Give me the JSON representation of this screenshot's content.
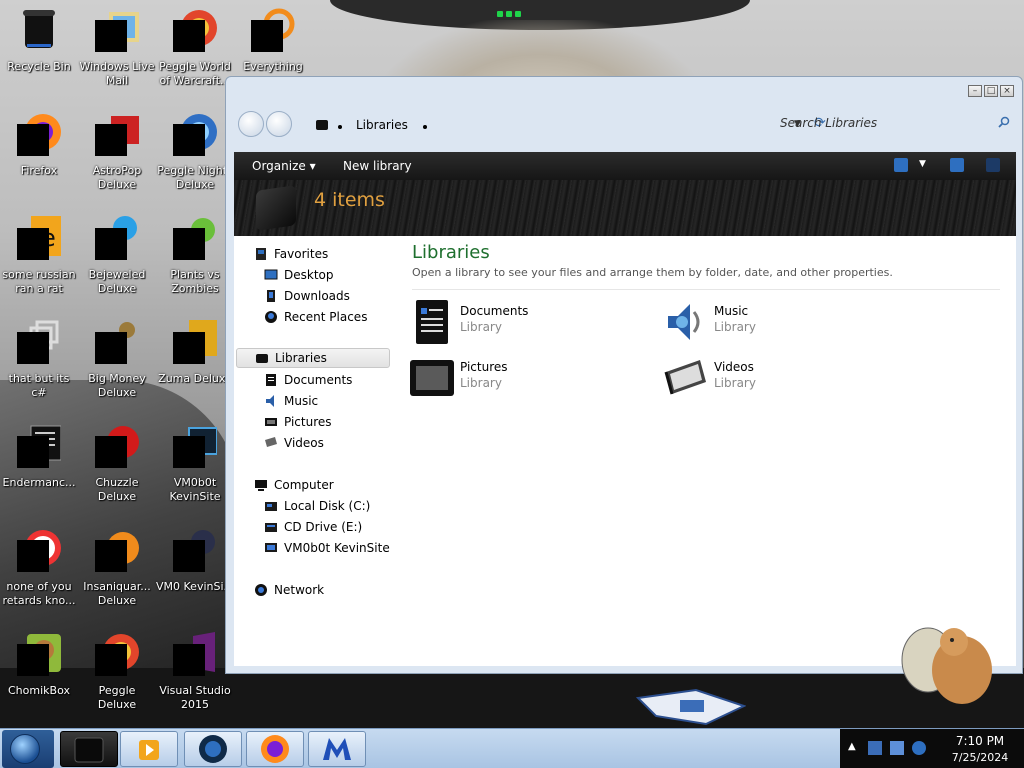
{
  "desktop": {
    "icons": [
      {
        "label": "Recycle Bin"
      },
      {
        "label": "Windows Live Mail"
      },
      {
        "label": "Peggle World of Warcraft..."
      },
      {
        "label": "Everything"
      },
      {
        "label": "Firefox"
      },
      {
        "label": "AstroPop Deluxe"
      },
      {
        "label": "Peggle Nights Deluxe"
      },
      {
        "label": "some russian ran a rat"
      },
      {
        "label": "Bejeweled Deluxe"
      },
      {
        "label": "Plants vs Zombies"
      },
      {
        "label": "that but its c#"
      },
      {
        "label": "Big Money Deluxe"
      },
      {
        "label": "Zuma Deluxe"
      },
      {
        "label": "Endermanc..."
      },
      {
        "label": "Chuzzle Deluxe"
      },
      {
        "label": "VM0b0t KevinSite"
      },
      {
        "label": "none of you retards kno..."
      },
      {
        "label": "Insaniquar... Deluxe"
      },
      {
        "label": "VM0 KevinSi..."
      },
      {
        "label": "ChomikBox"
      },
      {
        "label": "Peggle Deluxe"
      },
      {
        "label": "Visual Studio 2015"
      }
    ]
  },
  "window": {
    "address": {
      "location": "Libraries"
    },
    "search": {
      "placeholder": "Search Libraries"
    },
    "toolbar": {
      "organize": "Organize ▾",
      "new_library": "New library"
    },
    "banner": {
      "count": "4 items"
    },
    "nav": {
      "favorites": "Favorites",
      "desktop": "Desktop",
      "downloads": "Downloads",
      "recent": "Recent Places",
      "libraries": "Libraries",
      "documents": "Documents",
      "music": "Music",
      "pictures": "Pictures",
      "videos": "Videos",
      "computer": "Computer",
      "local_disk": "Local Disk (C:)",
      "cd_drive": "CD Drive (E:)",
      "vm_share": "VM0b0t KevinSite",
      "network": "Network"
    },
    "main": {
      "title": "Libraries",
      "description": "Open a library to see your files and arrange them by folder, date, and other properties.",
      "libraries": [
        {
          "name": "Documents",
          "type": "Library"
        },
        {
          "name": "Music",
          "type": "Library"
        },
        {
          "name": "Pictures",
          "type": "Library"
        },
        {
          "name": "Videos",
          "type": "Library"
        }
      ]
    }
  },
  "taskbar": {
    "clock": {
      "time": "7:10 PM",
      "date": "7/25/2024"
    }
  },
  "colors": {
    "library_title": "#1e6f2e",
    "banner_count": "#e0a040",
    "taskbar": "#b7cde8"
  }
}
